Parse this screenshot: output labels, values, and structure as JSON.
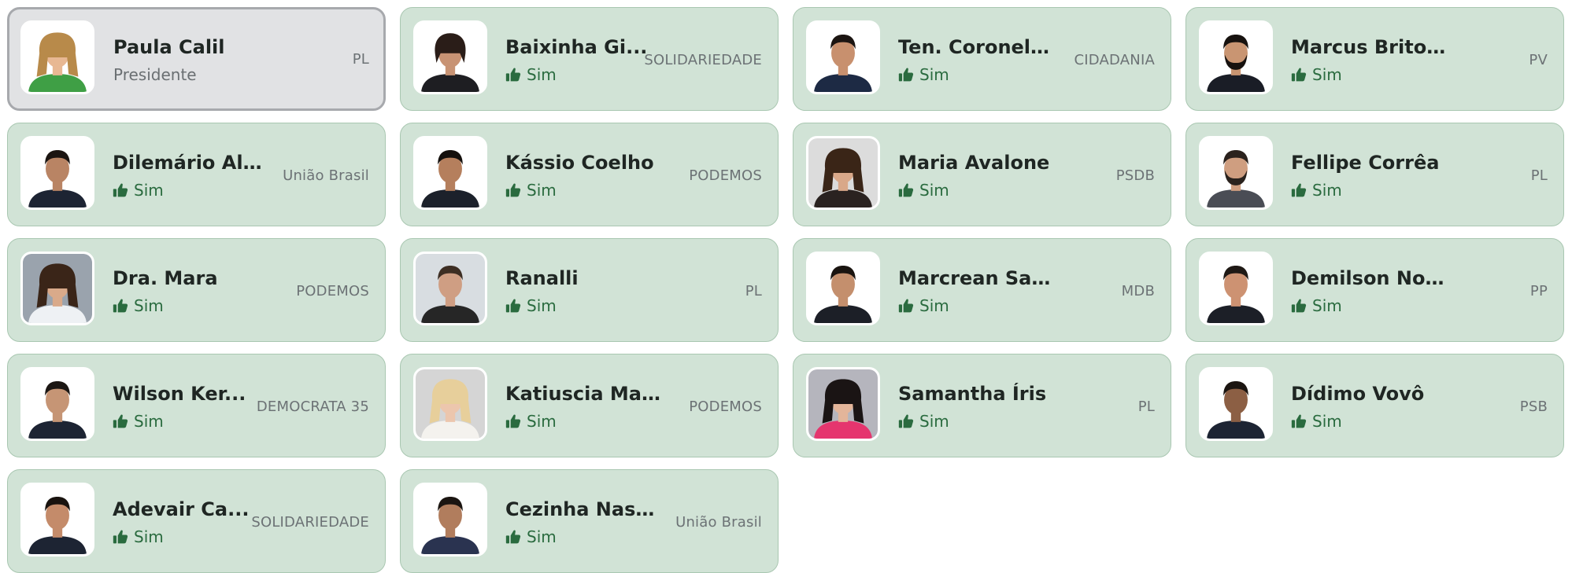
{
  "colors": {
    "card_bg": "#d1e3d6",
    "card_border": "#a9c7b1",
    "presidente_bg": "#e1e2e4",
    "presidente_border": "#a7a9ad",
    "vote_green": "#2a6b3f"
  },
  "members": [
    {
      "name": "Paula Calil",
      "party": "PL",
      "role": "Presidente",
      "vote": "",
      "photo": {
        "bg": "#ffffff",
        "skin": "#e8b893",
        "hair": "#b88a4a",
        "shirt": "#3f9f45",
        "hair_style": "long"
      }
    },
    {
      "name": "Baixinha Gi...",
      "party": "SOLIDARIEDADE",
      "role": "",
      "vote": "Sim",
      "photo": {
        "bg": "#ffffff",
        "skin": "#c89374",
        "hair": "#2a1d18",
        "shirt": "#1e1e22",
        "hair_style": "short-f"
      }
    },
    {
      "name": "Ten. Coronel D...",
      "party": "CIDADANIA",
      "role": "",
      "vote": "Sim",
      "photo": {
        "bg": "#ffffff",
        "skin": "#c8906e",
        "hair": "#1c1512",
        "shirt": "#1d2a44",
        "hair_style": "short"
      }
    },
    {
      "name": "Marcus Brito Junior",
      "party": "PV",
      "role": "",
      "vote": "Sim",
      "photo": {
        "bg": "#ffffff",
        "skin": "#c99572",
        "hair": "#17120f",
        "shirt": "#1a1d26",
        "hair_style": "beard"
      }
    },
    {
      "name": "Dilemário Ale...",
      "party": "União Brasil",
      "role": "",
      "vote": "Sim",
      "photo": {
        "bg": "#ffffff",
        "skin": "#b98464",
        "hair": "#1b1511",
        "shirt": "#1d2433",
        "hair_style": "short"
      }
    },
    {
      "name": "Kássio Coelho",
      "party": "PODEMOS",
      "role": "",
      "vote": "Sim",
      "photo": {
        "bg": "#ffffff",
        "skin": "#b57f5d",
        "hair": "#14100d",
        "shirt": "#1c212b",
        "hair_style": "short"
      }
    },
    {
      "name": "Maria Avalone",
      "party": "PSDB",
      "role": "",
      "vote": "Sim",
      "photo": {
        "bg": "#dcdcdc",
        "skin": "#d9a889",
        "hair": "#3a2517",
        "shirt": "#2a2220",
        "hair_style": "long"
      }
    },
    {
      "name": "Fellipe Corrêa",
      "party": "PL",
      "role": "",
      "vote": "Sim",
      "photo": {
        "bg": "#ffffff",
        "skin": "#cf9e80",
        "hair": "#2a221d",
        "shirt": "#4a4d55",
        "hair_style": "beard"
      }
    },
    {
      "name": "Dra. Mara",
      "party": "PODEMOS",
      "role": "",
      "vote": "Sim",
      "photo": {
        "bg": "#9aa3ad",
        "skin": "#d9aa8a",
        "hair": "#3a2518",
        "shirt": "#eef1f4",
        "hair_style": "long"
      }
    },
    {
      "name": "Ranalli",
      "party": "PL",
      "role": "",
      "vote": "Sim",
      "photo": {
        "bg": "#d8dde1",
        "skin": "#cf9e83",
        "hair": "#3d2e23",
        "shirt": "#262626",
        "hair_style": "short"
      }
    },
    {
      "name": "Marcrean Santos",
      "party": "MDB",
      "role": "",
      "vote": "Sim",
      "photo": {
        "bg": "#ffffff",
        "skin": "#c48f6d",
        "hair": "#1a1410",
        "shirt": "#1c1f27",
        "hair_style": "short"
      }
    },
    {
      "name": "Demilson Nogueira",
      "party": "PP",
      "role": "",
      "vote": "Sim",
      "photo": {
        "bg": "#ffffff",
        "skin": "#cd9272",
        "hair": "#1f1915",
        "shirt": "#1c1f27",
        "hair_style": "short"
      }
    },
    {
      "name": "Wilson Ker...",
      "party": "DEMOCRATA 35",
      "role": "",
      "vote": "Sim",
      "photo": {
        "bg": "#ffffff",
        "skin": "#c69575",
        "hair": "#1b1613",
        "shirt": "#1d2433",
        "hair_style": "short"
      }
    },
    {
      "name": "Katiuscia Manteli",
      "party": "PODEMOS",
      "role": "",
      "vote": "Sim",
      "photo": {
        "bg": "#d5d5d5",
        "skin": "#ecc6ad",
        "hair": "#e7cf9b",
        "shirt": "#f4f2ee",
        "hair_style": "long"
      }
    },
    {
      "name": "Samantha Íris",
      "party": "PL",
      "role": "",
      "vote": "Sim",
      "photo": {
        "bg": "#b5b5bd",
        "skin": "#e3b59a",
        "hair": "#1a1414",
        "shirt": "#e5356e",
        "hair_style": "long"
      }
    },
    {
      "name": "Dídimo Vovô",
      "party": "PSB",
      "role": "",
      "vote": "Sim",
      "photo": {
        "bg": "#ffffff",
        "skin": "#8c5f44",
        "hair": "#1b1511",
        "shirt": "#1d2433",
        "hair_style": "short"
      }
    },
    {
      "name": "Adevair Ca...",
      "party": "SOLIDARIEDADE",
      "role": "",
      "vote": "Sim",
      "photo": {
        "bg": "#ffffff",
        "skin": "#c48b6a",
        "hair": "#19130f",
        "shirt": "#1d2433",
        "hair_style": "short"
      }
    },
    {
      "name": "Cezinha Nasci...",
      "party": "União Brasil",
      "role": "",
      "vote": "Sim",
      "photo": {
        "bg": "#ffffff",
        "skin": "#b17d5d",
        "hair": "#1b1511",
        "shirt": "#2a3350",
        "hair_style": "short"
      }
    }
  ]
}
